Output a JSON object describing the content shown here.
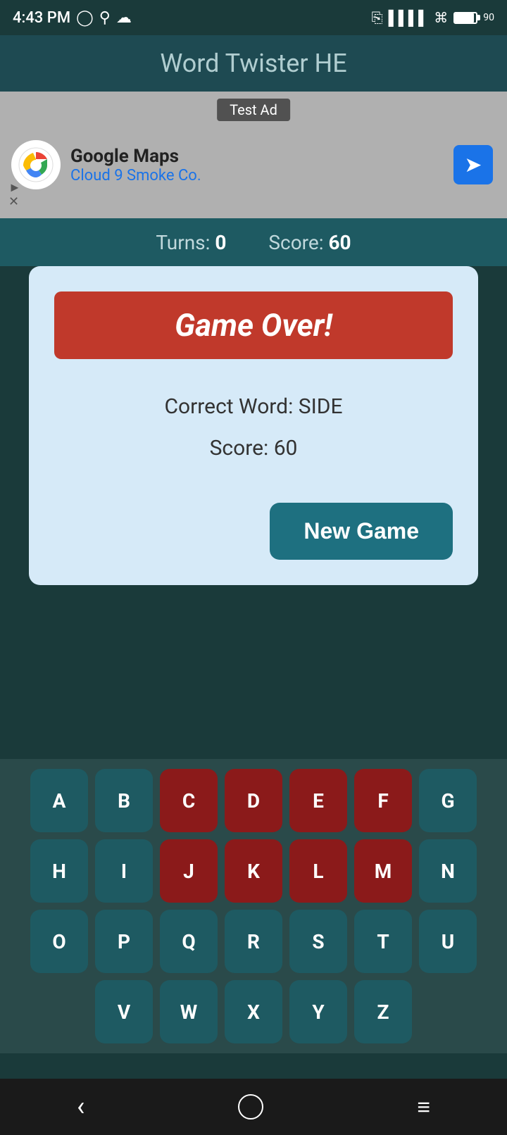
{
  "statusBar": {
    "time": "4:43 PM",
    "battery": "90"
  },
  "header": {
    "title": "Word Twister HE"
  },
  "ad": {
    "label": "Test Ad",
    "company": "Google Maps",
    "subtext": "Cloud 9 Smoke Co."
  },
  "scoreBar": {
    "turns_label": "Turns:",
    "turns_value": "0",
    "score_label": "Score:",
    "score_value": "60"
  },
  "modal": {
    "game_over": "Game Over!",
    "correct_word_label": "Correct Word: SIDE",
    "score_label": "Score: 60",
    "new_game_btn": "New Game"
  },
  "keyboard": {
    "rows": [
      [
        "A",
        "B",
        "C",
        "D",
        "E",
        "F",
        "G"
      ],
      [
        "H",
        "I",
        "J",
        "K",
        "L",
        "M",
        "N"
      ],
      [
        "O",
        "P",
        "Q",
        "R",
        "S",
        "T",
        "U"
      ],
      [
        "V",
        "W",
        "X",
        "Y",
        "Z"
      ]
    ],
    "used": [
      "C",
      "D",
      "E",
      "F",
      "J",
      "K",
      "L",
      "M"
    ]
  },
  "bottomNav": {
    "back": "‹",
    "home": "○",
    "menu": "≡"
  }
}
